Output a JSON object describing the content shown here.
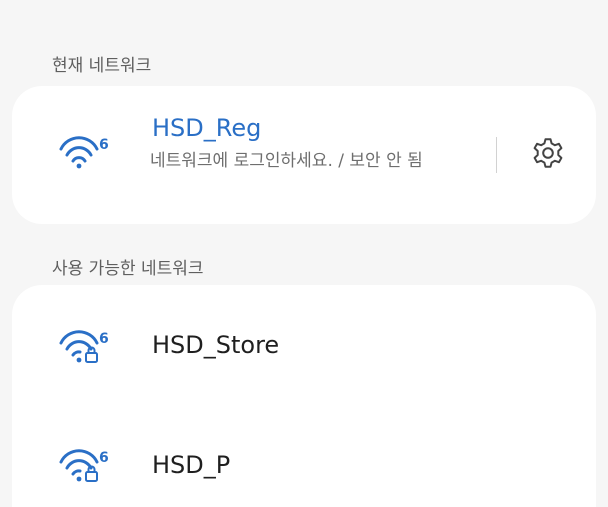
{
  "sections": {
    "current_header": "현재 네트워크",
    "available_header": "사용 가능한 네트워크"
  },
  "current_network": {
    "name": "HSD_Reg",
    "status": "네트워크에 로그인하세요. / 보안 안 됨",
    "wifi_standard": "6",
    "secured": false,
    "icon": "wifi-6-icon",
    "settings_icon": "gear-icon"
  },
  "available_networks": [
    {
      "name": "HSD_Store",
      "wifi_standard": "6",
      "secured": true,
      "icon": "wifi-6-lock-icon"
    },
    {
      "name": "HSD_P",
      "wifi_standard": "6",
      "secured": true,
      "icon": "wifi-6-lock-icon"
    }
  ],
  "colors": {
    "accent": "#2a6fc6",
    "background": "#f6f6f6",
    "card": "#ffffff",
    "text_primary": "#1f1f1f",
    "text_secondary": "#6e6e6e"
  }
}
